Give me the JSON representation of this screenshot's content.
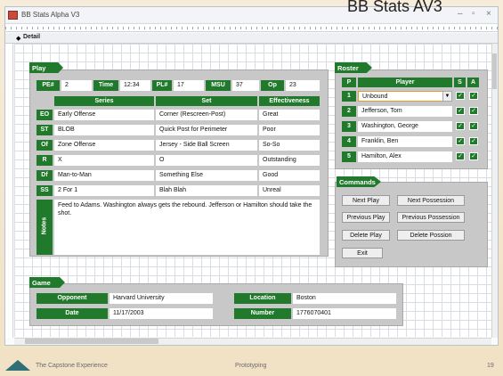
{
  "slide": {
    "title": "BB Stats AV3",
    "footer_left": "The Capstone Experience",
    "footer_center": "Prototyping",
    "page_number": "19"
  },
  "window": {
    "title": "BB Stats Alpha V3",
    "tab": "Detail"
  },
  "play": {
    "section_label": "Play",
    "fields": [
      {
        "label": "PE#",
        "value": "2"
      },
      {
        "label": "Time",
        "value": "12:34"
      },
      {
        "label": "PL#",
        "value": "17"
      },
      {
        "label": "MSU",
        "value": "37"
      },
      {
        "label": "Op",
        "value": "23"
      }
    ],
    "columns": [
      "Series",
      "Set",
      "Effectiveness"
    ],
    "rows": [
      {
        "code": "EO",
        "series": "Early Offense",
        "set": "Corner (Rescreen-Post)",
        "effectiveness": "Great"
      },
      {
        "code": "ST",
        "series": "BLOB",
        "set": "Quick Post for Perimeter",
        "effectiveness": "Poor"
      },
      {
        "code": "Of",
        "series": "Zone Offense",
        "set": "Jersey - Side Ball Screen",
        "effectiveness": "So-So"
      },
      {
        "code": "R",
        "series": "X",
        "set": "O",
        "effectiveness": "Outstanding"
      },
      {
        "code": "Df",
        "series": "Man-to-Man",
        "set": "Something Else",
        "effectiveness": "Good"
      },
      {
        "code": "SS",
        "series": "2 For 1",
        "set": "Blah Blah",
        "effectiveness": "Unreal"
      }
    ],
    "notes_label": "Notes",
    "notes_text": "Feed to Adams.  Washington always gets the rebound.  Jefferson or Hamilton should take the shot."
  },
  "roster": {
    "section_label": "Roster",
    "headers": [
      "P",
      "Player",
      "S",
      "A"
    ],
    "players": [
      {
        "pos": "1",
        "name": "Unbound",
        "s": "✓",
        "a": "✓"
      },
      {
        "pos": "2",
        "name": "Jefferson, Tom",
        "s": "✓",
        "a": "✓"
      },
      {
        "pos": "3",
        "name": "Washington, George",
        "s": "✓",
        "a": "✓"
      },
      {
        "pos": "4",
        "name": "Franklin, Ben",
        "s": "✓",
        "a": "✓"
      },
      {
        "pos": "5",
        "name": "Hamilton, Alex",
        "s": "✓",
        "a": "✓"
      }
    ]
  },
  "commands": {
    "section_label": "Commands",
    "next_play": "Next Play",
    "next_possession": "Next Possession",
    "previous_play": "Previous Play",
    "previous_possession": "Previous Possession",
    "delete_play": "Delete Play",
    "delete_possion": "Delete Possion",
    "exit": "Exit"
  },
  "game": {
    "section_label": "Game",
    "opponent_label": "Opponent",
    "opponent": "Harvard University",
    "location_label": "Location",
    "location": "Boston",
    "date_label": "Date",
    "date": "11/17/2003",
    "number_label": "Number",
    "number": "1776070401"
  },
  "colors": {
    "accent_green": "#217a2c",
    "panel_gray": "#c8c8c8",
    "background": "#f4e6cf"
  }
}
